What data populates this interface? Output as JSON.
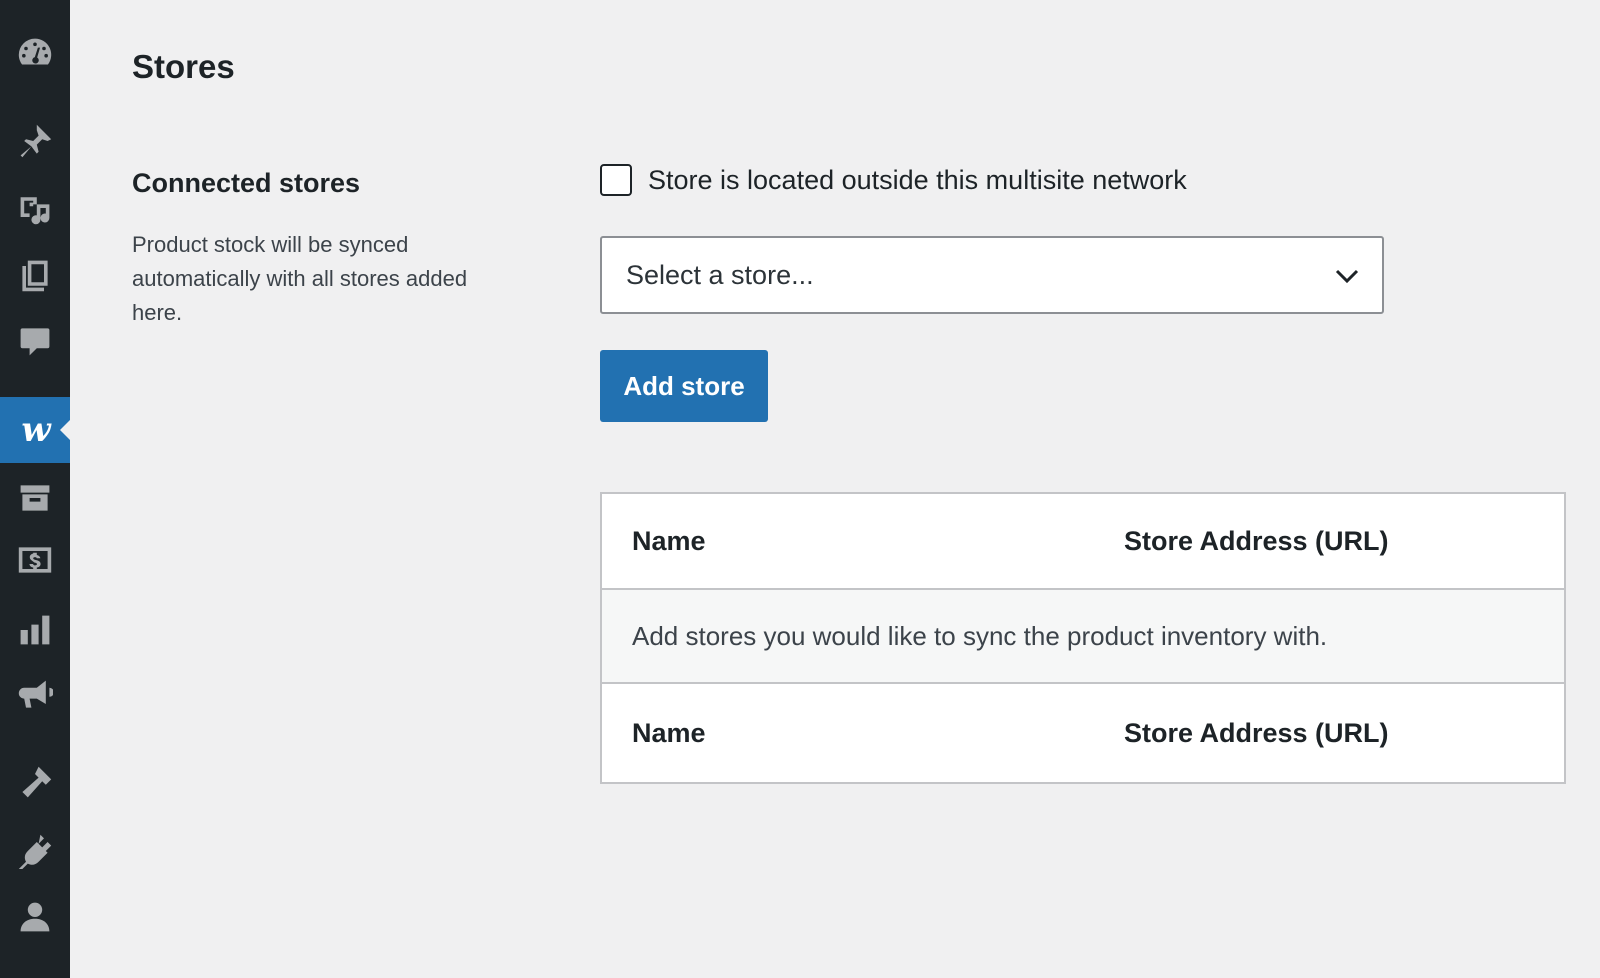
{
  "sidebar": {
    "items": [
      {
        "icon": "dashboard-icon"
      },
      {
        "icon": "pin-icon"
      },
      {
        "icon": "media-icon"
      },
      {
        "icon": "pages-icon"
      },
      {
        "icon": "comments-icon"
      },
      {
        "icon": "woocommerce-icon",
        "active": true,
        "glyph": "w"
      },
      {
        "icon": "archive-icon"
      },
      {
        "icon": "payments-icon"
      },
      {
        "icon": "analytics-icon"
      },
      {
        "icon": "marketing-icon"
      },
      {
        "icon": "appearance-icon"
      },
      {
        "icon": "plugins-icon"
      },
      {
        "icon": "users-icon"
      }
    ],
    "active_color": "#2271b1"
  },
  "page": {
    "title": "Stores"
  },
  "section": {
    "title": "Connected stores",
    "description": "Product stock will be synced automatically with all stores added here."
  },
  "form": {
    "checkbox_label": "Store is located outside this multisite network",
    "checkbox_checked": false,
    "select_placeholder": "Select a store...",
    "add_button_label": "Add store"
  },
  "table": {
    "columns": [
      "Name",
      "Store Address (URL)"
    ],
    "empty_message": "Add stores you would like to sync the product inventory with.",
    "footer_columns": [
      "Name",
      "Store Address (URL)"
    ]
  }
}
